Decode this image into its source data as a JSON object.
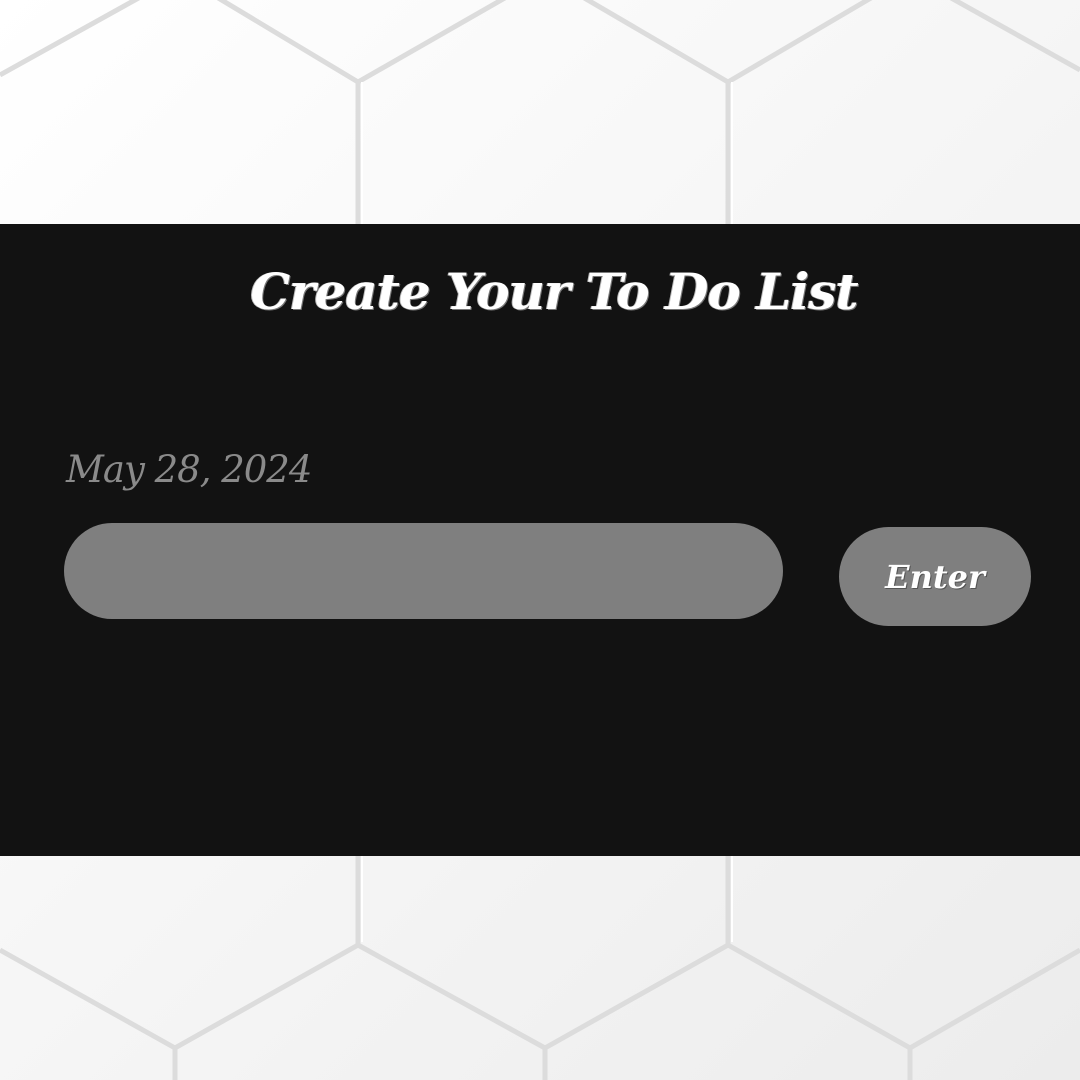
{
  "header": {
    "title": "Create Your To Do List"
  },
  "main": {
    "date": "May 28, 2024",
    "task_input": {
      "value": "",
      "placeholder": ""
    },
    "enter_label": "Enter"
  },
  "colors": {
    "panel_background": "#121212",
    "control_fill": "#7f7f7f",
    "title_text": "#ffffff",
    "date_text": "#8a8a8a",
    "page_background": "#f4f4f4"
  }
}
